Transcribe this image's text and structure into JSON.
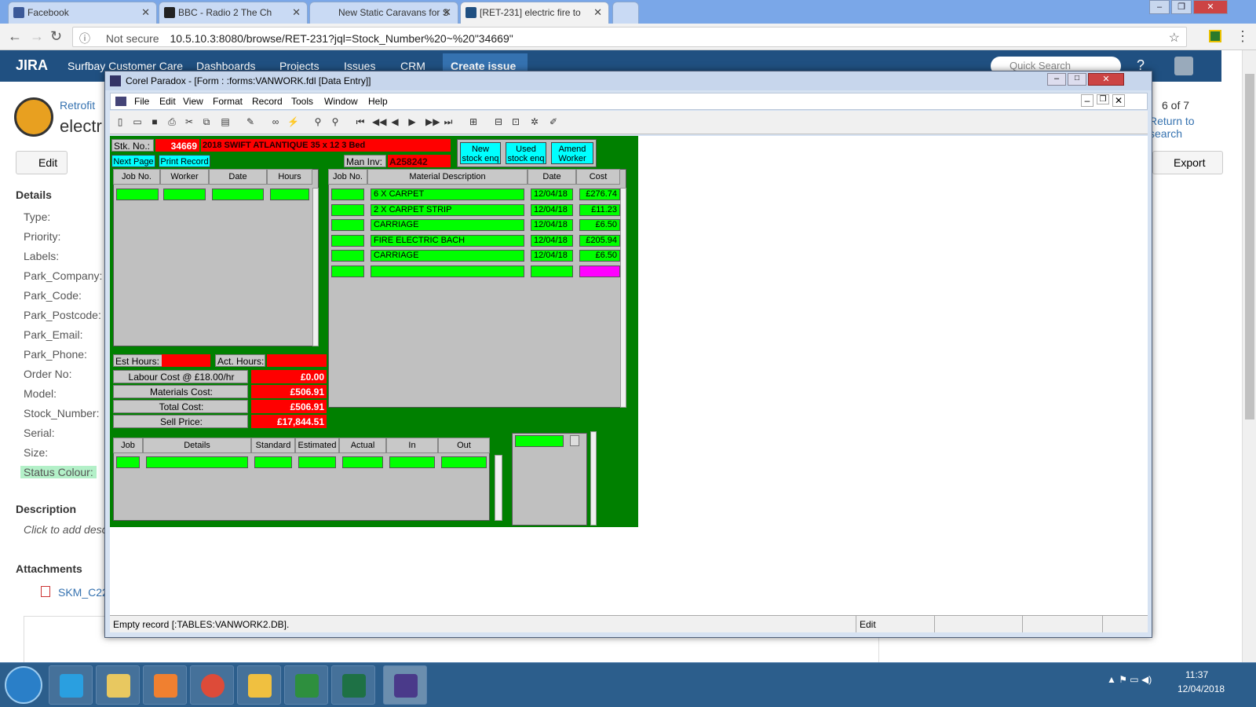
{
  "browser": {
    "tabs": [
      {
        "label": "Facebook",
        "color": "#3b5998"
      },
      {
        "label": "BBC - Radio 2 The Ch",
        "color": "#222222"
      },
      {
        "label": "New Static Caravans for S",
        "color": "#cccccc"
      },
      {
        "label": "[RET-231] electric fire to",
        "color": "#205081"
      }
    ],
    "security": "Not secure",
    "url": "10.5.10.3:8080/browse/RET-231?jql=Stock_Number%20~%20\"34669\""
  },
  "jira": {
    "logo": "JIRA",
    "nav": [
      "Surfbay Customer Care",
      "Dashboards",
      "Projects",
      "Issues",
      "CRM"
    ],
    "create": "Create issue",
    "search_placeholder": "Quick Search",
    "breadcrumb": "Retrofit",
    "issue_title": "electr",
    "pager": "6 of 7",
    "return": "Return to search",
    "edit": "Edit",
    "export": "Export",
    "details_heading": "Details",
    "fields": [
      "Type:",
      "Priority:",
      "Labels:",
      "Park_Company:",
      "Park_Code:",
      "Park_Postcode:",
      "Park_Email:",
      "Park_Phone:",
      "Order No:",
      "Model:",
      "Stock_Number:",
      "Serial:",
      "Size:",
      "Status Colour:"
    ],
    "description_heading": "Description",
    "description_text": "Click to add desc",
    "attachments_heading": "Attachments",
    "attachment_name": "SKM_C22"
  },
  "paradox": {
    "title": "Corel Paradox - [Form : :forms:VANWORK.fdl [Data Entry]]",
    "menus": [
      "File",
      "Edit",
      "View",
      "Format",
      "Record",
      "Tools",
      "Window",
      "Help"
    ],
    "stk_label": "Stk. No.:",
    "stk_no": "34669",
    "stk_desc": "2018 SWIFT ATLANTIQUE 35 x 12 3 Bed",
    "man_inv_label": "Man Inv:",
    "man_inv": "A258242",
    "btn_next_page": "Next Page",
    "btn_print_record": "Print Record",
    "btn_new_stock": "New stock enq",
    "btn_used_stock": "Used stock enq",
    "btn_amend_worker": "Amend Worker",
    "labour_headers": [
      "Job No.",
      "Worker",
      "Date",
      "Hours"
    ],
    "material_headers": [
      "Job No.",
      "Material Description",
      "Date",
      "Cost"
    ],
    "materials": [
      {
        "desc": "6 X CARPET",
        "date": "12/04/18",
        "cost": "£276.74"
      },
      {
        "desc": "2 X CARPET STRIP",
        "date": "12/04/18",
        "cost": "£11.23"
      },
      {
        "desc": "CARRIAGE",
        "date": "12/04/18",
        "cost": "£6.50"
      },
      {
        "desc": "FIRE ELECTRIC BACH",
        "date": "12/04/18",
        "cost": "£205.94"
      },
      {
        "desc": "CARRIAGE",
        "date": "12/04/18",
        "cost": "£6.50"
      }
    ],
    "est_hours_label": "Est Hours:",
    "act_hours_label": "Act. Hours:",
    "labour_cost_label": "Labour Cost @ £18.00/hr",
    "labour_cost": "£0.00",
    "materials_cost_label": "Materials Cost:",
    "materials_cost": "£506.91",
    "total_cost_label": "Total Cost:",
    "total_cost": "£506.91",
    "sell_price_label": "Sell Price:",
    "sell_price": "£17,844.51",
    "job_headers": [
      "Job",
      "Details",
      "Standard",
      "Estimated",
      "Actual",
      "In",
      "Out"
    ],
    "status_message": "Empty record [:TABLES:VANWORK2.DB].",
    "status_mode": "Edit"
  },
  "taskbar": {
    "time": "11:37",
    "date": "12/04/2018"
  }
}
